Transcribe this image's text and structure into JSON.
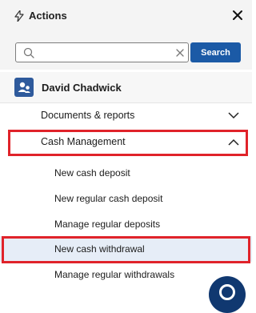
{
  "header": {
    "title": "Actions"
  },
  "search": {
    "placeholder": "",
    "value": "",
    "button_label": "Search"
  },
  "user": {
    "name": "David Chadwick"
  },
  "menu": {
    "documents_label": "Documents & reports",
    "cash_management_label": "Cash Management",
    "sub_items": [
      "New cash deposit",
      "New regular cash deposit",
      "Manage regular deposits",
      "New cash withdrawal",
      "Manage regular withdrawals"
    ]
  },
  "colors": {
    "accent": "#1b5aa6",
    "highlight": "#e0232a",
    "selected": "#e6edf7",
    "fab": "#103870"
  }
}
